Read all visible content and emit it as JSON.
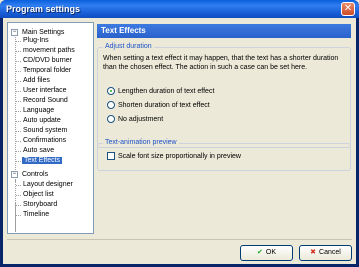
{
  "window": {
    "title": "Program settings",
    "close_glyph": "✕"
  },
  "tree": {
    "groups": [
      {
        "label": "Main Settings",
        "toggle": "−",
        "items": [
          "Plug-Ins",
          "movement paths",
          "CD/DVD burner",
          "Temporal folder",
          "Add files",
          "User interface",
          "Record Sound",
          "Language",
          "Auto update",
          "Sound system",
          "Confirmations",
          "Auto save",
          "Text Effects"
        ]
      },
      {
        "label": "Controls",
        "toggle": "−",
        "items": [
          "Layout designer",
          "Object list",
          "Storyboard",
          "Timeline"
        ]
      }
    ],
    "selected": "Text Effects"
  },
  "panel": {
    "title": "Text Effects",
    "adjust": {
      "title": "Adjust duration",
      "description": "When setting a text effect it may happen, that the text has a shorter duration than the chosen effect. The action in such a case can be set here.",
      "options": [
        {
          "label": "Lengthen duration of text effect",
          "checked": true
        },
        {
          "label": "Shorten duration of text effect",
          "checked": false
        },
        {
          "label": "No adjustment",
          "checked": false
        }
      ]
    },
    "preview": {
      "title": "Text-animation preview",
      "checkbox_label": "Scale font size proportionally in preview",
      "checked": false
    }
  },
  "buttons": {
    "ok_label": "OK",
    "ok_icon": "✔",
    "ok_color": "#22a622",
    "cancel_label": "Cancel",
    "cancel_icon": "✖",
    "cancel_color": "#d22f1f"
  }
}
